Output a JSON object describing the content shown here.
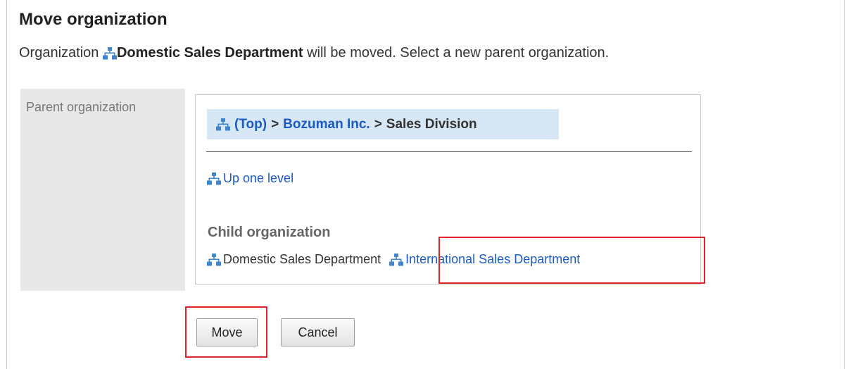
{
  "page": {
    "title": "Move organization",
    "description": {
      "prefix": "Organization",
      "org_name": "Domestic Sales Department",
      "suffix": "will be moved. Select a new parent organization."
    }
  },
  "form": {
    "parent_label": "Parent organization",
    "breadcrumb": {
      "items": [
        "(Top)",
        "Bozuman Inc.",
        "Sales Division"
      ],
      "separator": ">"
    },
    "up_one_level": "Up one level",
    "child_heading": "Child organization",
    "children": [
      {
        "label": "Domestic Sales Department",
        "selectable": false
      },
      {
        "label": "International Sales Department",
        "selectable": true,
        "highlighted": true
      }
    ]
  },
  "buttons": {
    "move": "Move",
    "cancel": "Cancel"
  },
  "icons": {
    "organization": "org-chart-icon"
  },
  "colors": {
    "link": "#1a5bc4",
    "icon": "#3d86cf",
    "breadcrumb_bg": "#d7e7f5",
    "highlight": "#e0242b"
  }
}
